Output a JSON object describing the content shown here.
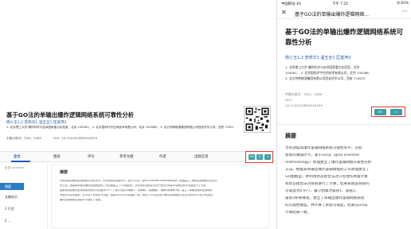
{
  "desktop": {
    "title": "基于GO法的单输出爆炸逻辑网络系统可靠性分析",
    "authors": "杨小玉1,2  李燕华1  温玉全1  匡富萍3",
    "affiliations": [
      "1. 北京理工大学 爆炸科学与技术国家重点实验室，北京 100081； 2. 北京国科环宇空间技术有限公司，北京 100086； 3. 北方特种能源集团有限公司西安庆华公司，西安 710025",
      "中图分类号：TJ55；O389"
    ],
    "meta": {
      "clc": "中图分类号：TJ55；O389",
      "doi": "DOI：10.11943/CJEM2018329"
    },
    "tabs": [
      "全文",
      "图表",
      "评论",
      "参考文献",
      "作者",
      "出版信息"
    ],
    "toolbar": {
      "en": "EN",
      "cite": "引",
      "share": "<"
    },
    "sidebar": {
      "title": "目录 contents",
      "items": [
        "摘要",
        "文献标识",
        "1 引言",
        "2 ..."
      ]
    },
    "abstract": {
      "title": "摘要",
      "lines": [
        "为有效提高爆炸逻辑网络可靠性水平，识别系统的薄弱环节，基于GO法（goal oriented methodology）原理建立了爆炸逻辑网络可靠性分",
        "析方法。根据某单输出爆炸逻辑网络的工作原理建立了GO图模型，并利用状态组合法对只考虑作用量计算输出的可靠度进行了计算，",
        "结果表明该爆炸逻辑网络系统的可靠度为0.977，最小割集为爆管1、导爆管1、起爆器1、爆管2和爆管3等。建立了单输出爆炸逻辑网络",
        "系统的可靠性模型，并计算了系统的可靠度，结果与GO法计算结果一致，验证了GO法应用于爆炸逻辑网络可靠性分析的可行性与有效性。",
        "爆炸逻辑网络的薄弱环节提供了依据。"
      ]
    }
  },
  "mobile": {
    "status": {
      "carrier": "中国移动",
      "network": "4G",
      "time": "下午 7:25",
      "battery": "◔ 83%"
    },
    "nav": {
      "close": "✕",
      "title": "基于GO法的单输出爆炸逻辑网络...",
      "more": "···"
    },
    "title": "基于GO法的单输出爆炸逻辑网络系统可靠性分析",
    "authors": "杨小玉1,2  李燕华1  温玉全1  匡富萍3",
    "affiliations": [
      "1. 北京理工大学 爆炸科学与技术国家重点实验室，北京",
      "100081；   2. 北京国科环宇空间技术有限公司，北京 100086；",
      "3. 北方特种能源集团有限公司西安庆华公司，西安 710025"
    ],
    "meta": [
      "中图分类号：TJ55；O389",
      "DOI：",
      "10.11943/CJEM2018329"
    ],
    "toolbar": {
      "en": "EN",
      "share": "<"
    },
    "abstract": {
      "title": "摘要",
      "lines": [
        "为有效提高爆炸逻辑网络系统可靠性水平，识别",
        "系统的薄弱环节，基于GO法（goal oriented",
        "methodology）原理建立了爆炸逻辑网络可靠性分析",
        "方法。根据某单输出爆炸逻辑网络的工作原理建立了",
        "GO图模型，并利用状态组合法对只考虑作用量计算",
        "和状态组合法对系统进行了计算，结果表明该系统的",
        "可靠度为0.977，最小割集为雷管1、雷管2、",
        "雷管3和导爆管。建立了单输出爆炸逻辑网络系统",
        "的可靠性模型，并计算了系统可靠度，结果与GO法",
        "计算结果一致。"
      ]
    }
  },
  "colors": {
    "accent": "#1a5fb4",
    "highlight": "#e8362c",
    "tool": "#3aa0a8"
  }
}
